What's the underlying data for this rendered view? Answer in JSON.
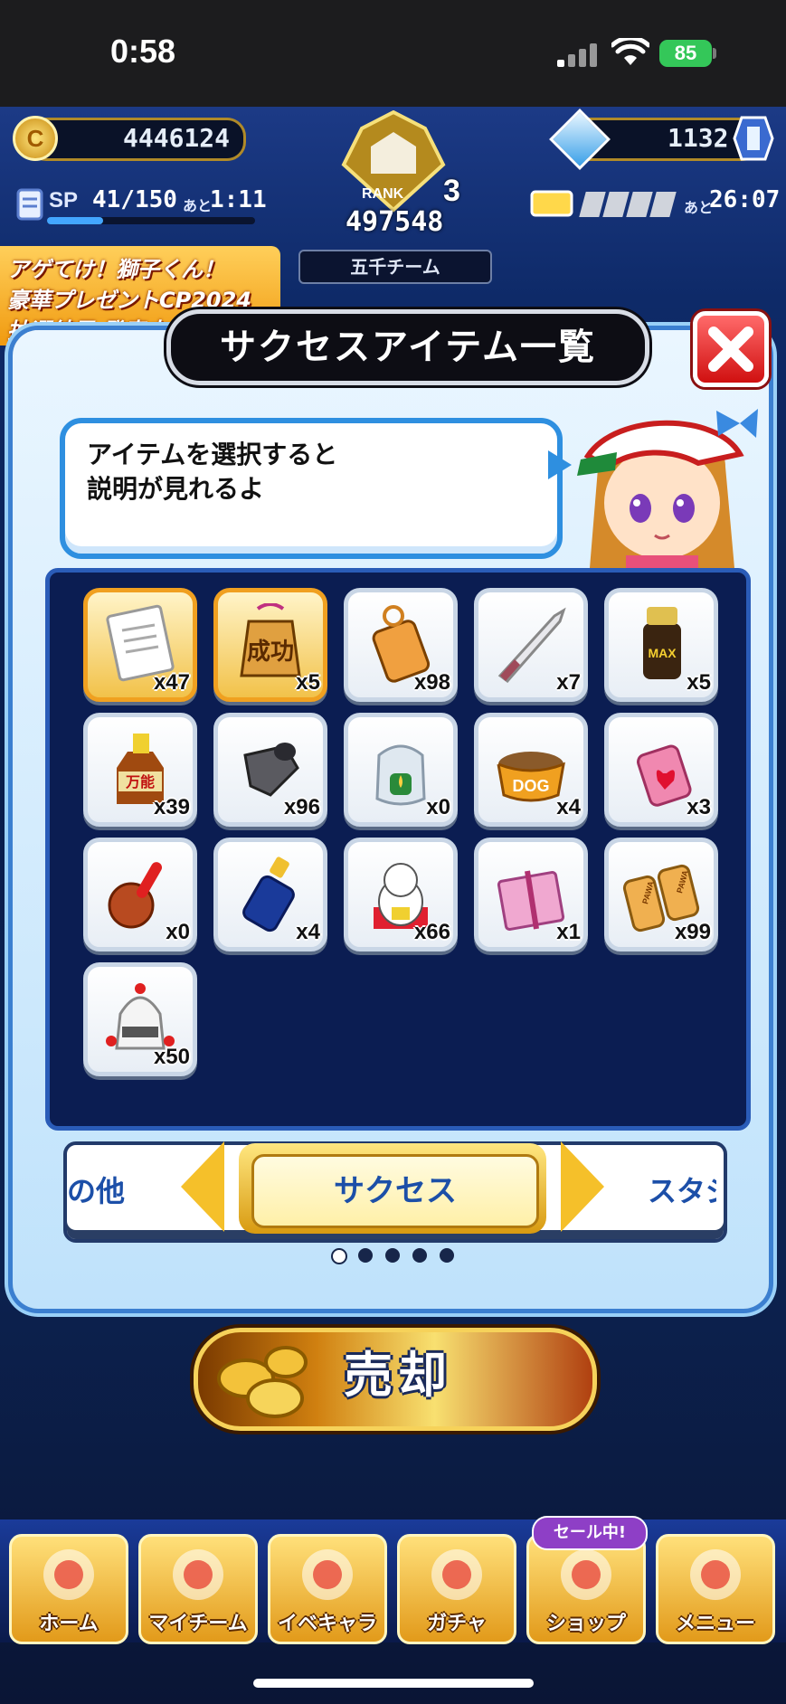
{
  "status_bar": {
    "time": "0:58",
    "battery": "85"
  },
  "hud": {
    "coins": "4446124",
    "gems": "1132",
    "sp_label": "SP",
    "sp_value": "41/150",
    "sp_suffix": "あと",
    "sp_timer": "1:11",
    "rank_label": "RANK",
    "rank_level": "3",
    "rank_points": "497548",
    "team_name": "五千チーム",
    "stamina_suffix": "あと",
    "stamina_timer": "26:07"
  },
  "banner": {
    "line1": "アゲてけ！獅子くん！",
    "line2": "豪華プレゼントCP2024",
    "line3": "抽選結果 発表中"
  },
  "dialog": {
    "title": "サクセスアイテム一覧",
    "hint": "アイテムを選択すると\n説明が見れるよ",
    "items": [
      {
        "icon": "document-icon",
        "qty": "x47",
        "selected": true
      },
      {
        "icon": "success-charm-icon",
        "qty": "x5",
        "selected": true,
        "text": "成功"
      },
      {
        "icon": "omamori-icon",
        "qty": "x98"
      },
      {
        "icon": "knife-icon",
        "qty": "x7"
      },
      {
        "icon": "max-bottle-icon",
        "qty": "x5",
        "text": "MAX"
      },
      {
        "icon": "manno-bottle-icon",
        "qty": "x39",
        "text": "万能"
      },
      {
        "icon": "pipe-icon",
        "qty": "x96"
      },
      {
        "icon": "aroma-pot-icon",
        "qty": "x0"
      },
      {
        "icon": "dog-bowl-icon",
        "qty": "x4",
        "text": "DOG"
      },
      {
        "icon": "heart-charm-icon",
        "qty": "x3"
      },
      {
        "icon": "drum-stick-icon",
        "qty": "x0"
      },
      {
        "icon": "blue-bottle-icon",
        "qty": "x4"
      },
      {
        "icon": "lucky-cat-icon",
        "qty": "x66"
      },
      {
        "icon": "gift-box-icon",
        "qty": "x1"
      },
      {
        "icon": "pawa-biscuit-icon",
        "qty": "x99",
        "text": "PAWA"
      },
      {
        "icon": "robot-icon",
        "qty": "x50"
      }
    ],
    "tabs": {
      "prev": "の他",
      "current": "サクセス",
      "next": "スタジ"
    },
    "page_dots": 5
  },
  "sell_label": "売却",
  "bottom_nav": [
    {
      "label": "ホーム",
      "icon": "home-icon"
    },
    {
      "label": "マイチーム",
      "icon": "my-team-icon"
    },
    {
      "label": "イベキャラ",
      "icon": "event-character-icon"
    },
    {
      "label": "ガチャ",
      "icon": "gacha-icon"
    },
    {
      "label": "ショップ",
      "icon": "shop-icon"
    },
    {
      "label": "メニュー",
      "icon": "menu-icon"
    }
  ],
  "sale_badge": "セール中!",
  "colors": {
    "accent_blue": "#2e8fe0",
    "panel_navy": "#0b1d52",
    "gold": "#f0a020",
    "close_red": "#d01010"
  }
}
